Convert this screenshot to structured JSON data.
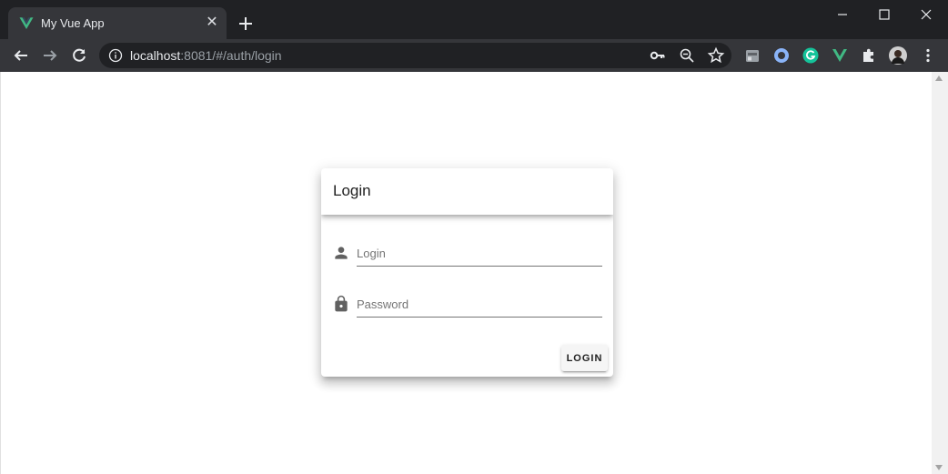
{
  "browser": {
    "tab_title": "My Vue App",
    "url_host": "localhost",
    "url_rest": ":8081/#/auth/login"
  },
  "colors": {
    "vue_green": "#41b883",
    "chrome_dark": "#202124",
    "chrome_toolbar": "#35363a"
  },
  "login_card": {
    "title": "Login",
    "login_placeholder": "Login",
    "password_placeholder": "Password",
    "submit_label": "LOGIN"
  }
}
